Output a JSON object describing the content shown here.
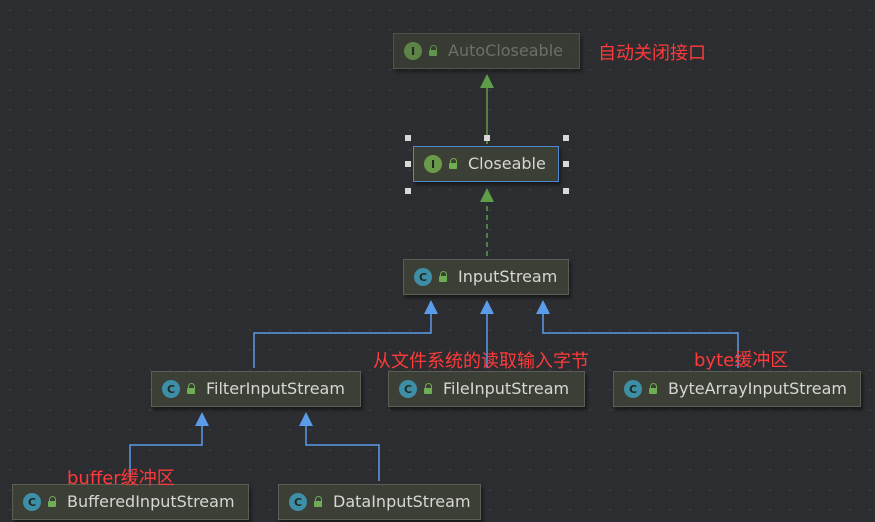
{
  "nodes": {
    "autocloseable": {
      "name": "AutoCloseable",
      "kind": "I"
    },
    "closeable": {
      "name": "Closeable",
      "kind": "I"
    },
    "inputstream": {
      "name": "InputStream",
      "kind": "C"
    },
    "filterinputstream": {
      "name": "FilterInputStream",
      "kind": "C"
    },
    "fileinputstream": {
      "name": "FileInputStream",
      "kind": "C"
    },
    "bytearrayinputstream": {
      "name": "ByteArrayInputStream",
      "kind": "C"
    },
    "bufferedinputstream": {
      "name": "BufferedInputStream",
      "kind": "C"
    },
    "datainputstream": {
      "name": "DataInputStream",
      "kind": "C"
    }
  },
  "annotations": {
    "autocloseable": "自动关闭接口",
    "fileinputstream": "从文件系统的读取输入字节",
    "bytearrayinputstream": "byte缓冲区",
    "bufferedinputstream": "buffer缓冲区"
  },
  "colors": {
    "background": "#2b2d30",
    "node_fill": "#3c3f36",
    "implements_edge": "#5f9e48",
    "extends_edge": "#5b9ce8",
    "annotation": "#ff3a3a",
    "selection": "#4f8ad1"
  }
}
